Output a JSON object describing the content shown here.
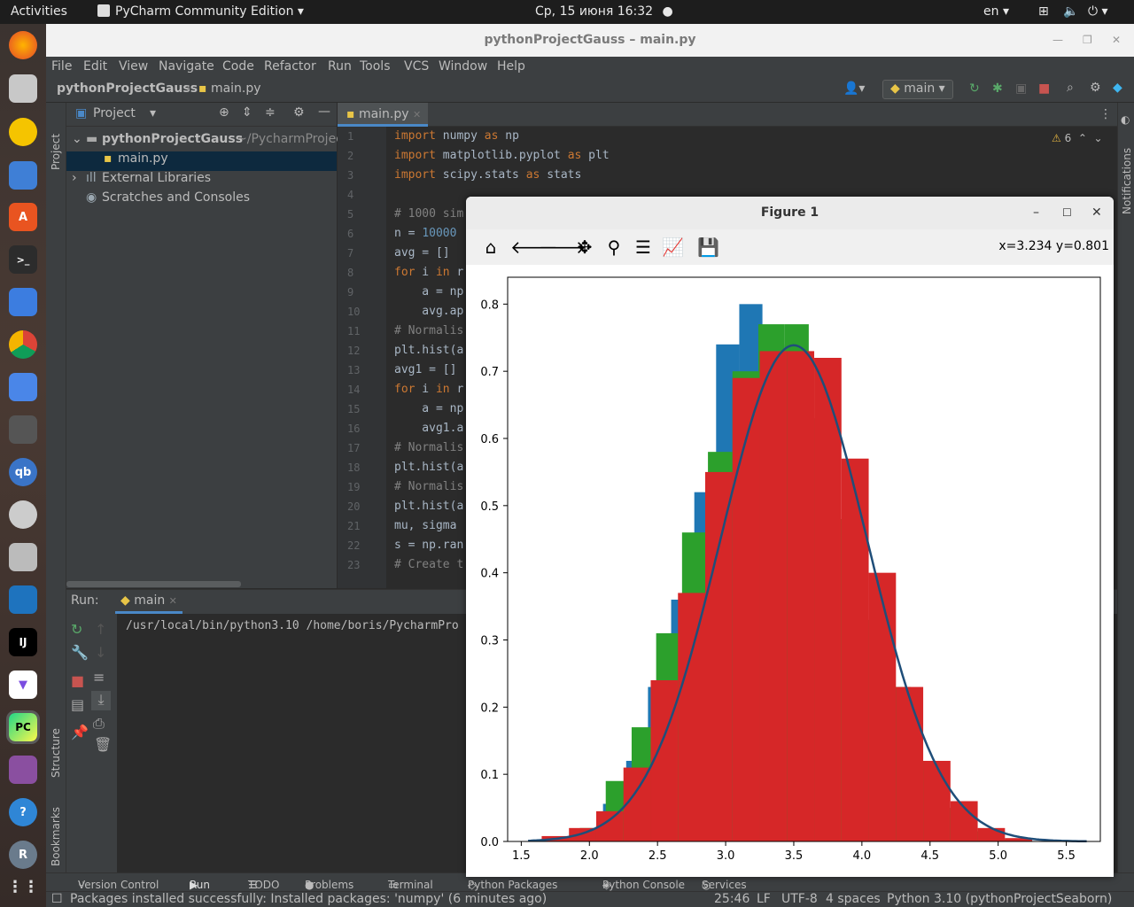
{
  "topbar": {
    "activities": "Activities",
    "app": "PyCharm Community Edition",
    "clock": "Ср, 15 июня  16:32",
    "lang": "en"
  },
  "window": {
    "title": "pythonProjectGauss – main.py"
  },
  "menu": [
    "File",
    "Edit",
    "View",
    "Navigate",
    "Code",
    "Refactor",
    "Run",
    "Tools",
    "VCS",
    "Window",
    "Help"
  ],
  "nav": {
    "project": "pythonProjectGauss",
    "file": "main.py",
    "branch": "main"
  },
  "left_tabs": {
    "project": "Project",
    "structure": "Structure",
    "bookmarks": "Bookmarks"
  },
  "right_tabs": {
    "notifications": "Notifications"
  },
  "project_panel": {
    "header": "Project",
    "root": "pythonProjectGauss",
    "root_path": "~/PycharmProjec",
    "file": "main.py",
    "libs": "External Libraries",
    "scratches": "Scratches and Consoles"
  },
  "editor": {
    "tab": "main.py",
    "warnings": "6",
    "lines": [
      {
        "n": "1",
        "parts": [
          [
            "kw",
            "import"
          ],
          [
            "t",
            " numpy "
          ],
          [
            "kw",
            "as"
          ],
          [
            "t",
            " np"
          ]
        ]
      },
      {
        "n": "2",
        "parts": [
          [
            "kw",
            "import"
          ],
          [
            "t",
            " matplotlib.pyplot "
          ],
          [
            "kw",
            "as"
          ],
          [
            "t",
            " plt"
          ]
        ]
      },
      {
        "n": "3",
        "parts": [
          [
            "kw",
            "import"
          ],
          [
            "t",
            " scipy.stats "
          ],
          [
            "kw",
            "as"
          ],
          [
            "t",
            " stats"
          ]
        ]
      },
      {
        "n": "4",
        "parts": []
      },
      {
        "n": "5",
        "parts": [
          [
            "cm",
            "# 1000 sim"
          ]
        ]
      },
      {
        "n": "6",
        "parts": [
          [
            "t",
            "n = "
          ],
          [
            "num",
            "10000"
          ]
        ]
      },
      {
        "n": "7",
        "parts": [
          [
            "t",
            "avg = []"
          ]
        ]
      },
      {
        "n": "8",
        "parts": [
          [
            "kw",
            "for"
          ],
          [
            "t",
            " i "
          ],
          [
            "kw",
            "in"
          ],
          [
            "t",
            " r"
          ]
        ]
      },
      {
        "n": "9",
        "parts": [
          [
            "t",
            "    a = np"
          ]
        ]
      },
      {
        "n": "10",
        "parts": [
          [
            "t",
            "    avg.ap"
          ]
        ]
      },
      {
        "n": "11",
        "parts": [
          [
            "cm",
            "# Normalis"
          ]
        ]
      },
      {
        "n": "12",
        "parts": [
          [
            "t",
            "plt.hist(a"
          ]
        ]
      },
      {
        "n": "13",
        "parts": [
          [
            "t",
            "avg1 = []"
          ]
        ]
      },
      {
        "n": "14",
        "parts": [
          [
            "kw",
            "for"
          ],
          [
            "t",
            " i "
          ],
          [
            "kw",
            "in"
          ],
          [
            "t",
            " r"
          ]
        ]
      },
      {
        "n": "15",
        "parts": [
          [
            "t",
            "    a = np"
          ]
        ]
      },
      {
        "n": "16",
        "parts": [
          [
            "t",
            "    avg1.a"
          ]
        ]
      },
      {
        "n": "17",
        "parts": [
          [
            "cm",
            "# Normalis"
          ]
        ]
      },
      {
        "n": "18",
        "parts": [
          [
            "t",
            "plt.hist(a"
          ]
        ]
      },
      {
        "n": "19",
        "parts": [
          [
            "cm",
            "# Normalis"
          ]
        ]
      },
      {
        "n": "20",
        "parts": [
          [
            "t",
            "plt.hist(a"
          ]
        ]
      },
      {
        "n": "21",
        "parts": [
          [
            "t",
            "mu, sigma"
          ]
        ]
      },
      {
        "n": "22",
        "parts": [
          [
            "t",
            "s = np.ran"
          ]
        ]
      },
      {
        "n": "23",
        "parts": [
          [
            "cm",
            "# Create t"
          ]
        ]
      }
    ]
  },
  "run_panel": {
    "label": "Run:",
    "tab": "main",
    "output": "/usr/local/bin/python3.10 /home/boris/PycharmPro"
  },
  "bottom_tabs": [
    "Version Control",
    "Run",
    "TODO",
    "Problems",
    "Terminal",
    "Python Packages",
    "Python Console",
    "Services"
  ],
  "status": {
    "message": "Packages installed successfully: Installed packages: 'numpy' (6 minutes ago)",
    "pos": "25:46",
    "eol": "LF",
    "enc": "UTF-8",
    "indent": "4 spaces",
    "interp": "Python 3.10 (pythonProjectSeaborn)"
  },
  "figure": {
    "title": "Figure 1",
    "coords": "x=3.234 y=0.801"
  },
  "chart_data": {
    "type": "bar",
    "xlim": [
      1.4,
      5.75
    ],
    "ylim": [
      0,
      0.84
    ],
    "xticks": [
      "1.5",
      "2.0",
      "2.5",
      "3.0",
      "3.5",
      "4.0",
      "4.5",
      "5.0",
      "5.5"
    ],
    "yticks": [
      "0.0",
      "0.1",
      "0.2",
      "0.3",
      "0.4",
      "0.5",
      "0.6",
      "0.7",
      "0.8"
    ],
    "series": [
      {
        "color": "#1f77b4",
        "edges": [
          1.6,
          1.77,
          1.93,
          2.1,
          2.27,
          2.43,
          2.6,
          2.77,
          2.93,
          3.1,
          3.27,
          3.43,
          3.6,
          3.77,
          3.93,
          4.1,
          4.27,
          4.43,
          4.6,
          4.77,
          4.93,
          5.1
        ],
        "values": [
          0.002,
          0.006,
          0.018,
          0.056,
          0.12,
          0.23,
          0.36,
          0.52,
          0.74,
          0.8,
          0.74,
          0.62,
          0.52,
          0.34,
          0.23,
          0.12,
          0.056,
          0.025,
          0.01,
          0.004,
          0.001
        ]
      },
      {
        "color": "#2ca02c",
        "edges": [
          1.75,
          1.93,
          2.12,
          2.31,
          2.49,
          2.68,
          2.87,
          3.05,
          3.24,
          3.43,
          3.61,
          3.8,
          3.99,
          4.17,
          4.36,
          4.55,
          4.73,
          4.92,
          5.11
        ],
        "values": [
          0.005,
          0.02,
          0.09,
          0.17,
          0.31,
          0.46,
          0.58,
          0.7,
          0.77,
          0.77,
          0.63,
          0.48,
          0.33,
          0.23,
          0.12,
          0.05,
          0.015,
          0.003
        ]
      },
      {
        "color": "#d62728",
        "edges": [
          1.65,
          1.85,
          2.05,
          2.25,
          2.45,
          2.65,
          2.85,
          3.05,
          3.25,
          3.45,
          3.65,
          3.85,
          4.05,
          4.25,
          4.45,
          4.65,
          4.85,
          5.05,
          5.25
        ],
        "values": [
          0.008,
          0.02,
          0.045,
          0.11,
          0.24,
          0.37,
          0.55,
          0.69,
          0.73,
          0.73,
          0.72,
          0.57,
          0.4,
          0.23,
          0.12,
          0.06,
          0.02,
          0.005
        ]
      }
    ],
    "curve": {
      "color": "#1f4e79",
      "mu": 3.5,
      "sigma": 0.54,
      "from": 1.55,
      "to": 5.65
    }
  }
}
